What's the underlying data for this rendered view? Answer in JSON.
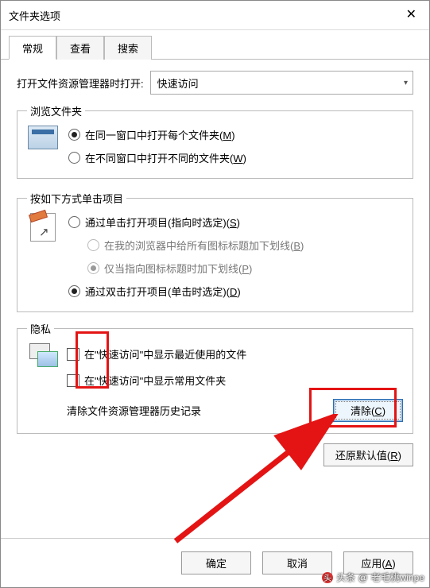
{
  "titlebar": {
    "title": "文件夹选项",
    "close_glyph": "✕"
  },
  "tabs": [
    {
      "label": "常规",
      "active": true
    },
    {
      "label": "查看",
      "active": false
    },
    {
      "label": "搜索",
      "active": false
    }
  ],
  "open_row": {
    "label": "打开文件资源管理器时打开:",
    "selected": "快速访问"
  },
  "group_browse": {
    "title": "浏览文件夹",
    "opt_same_window": "在同一窗口中打开每个文件夹(",
    "opt_same_window_mn": "M",
    "opt_same_window_close": ")",
    "opt_new_window": "在不同窗口中打开不同的文件夹(",
    "opt_new_window_mn": "W",
    "opt_new_window_close": ")"
  },
  "group_click": {
    "title": "按如下方式单击项目",
    "opt_single": "通过单击打开项目(指向时选定)(",
    "opt_single_mn": "S",
    "opt_single_close": ")",
    "sub_all_titles": "在我的浏览器中给所有图标标题加下划线(",
    "sub_all_titles_mn": "B",
    "sub_all_titles_close": ")",
    "sub_point_titles": "仅当指向图标标题时加下划线(",
    "sub_point_titles_mn": "P",
    "sub_point_titles_close": ")",
    "opt_double": "通过双击打开项目(单击时选定)(",
    "opt_double_mn": "D",
    "opt_double_close": ")"
  },
  "group_privacy": {
    "title": "隐私",
    "show_recent": "在\"快速访问\"中显示最近使用的文件",
    "show_frequent": "在\"快速访问\"中显示常用文件夹",
    "clear_label": "清除文件资源管理器历史记录",
    "clear_button": "清除(",
    "clear_button_mn": "C",
    "clear_button_close": ")"
  },
  "restore_defaults": {
    "label": "还原默认值(",
    "mn": "R",
    "close": ")"
  },
  "footer": {
    "ok": "确定",
    "cancel": "取消",
    "apply": "应用(",
    "apply_mn": "A",
    "apply_close": ")"
  },
  "watermark": {
    "prefix": "头条 @",
    "text": "老毛桃winpe"
  }
}
